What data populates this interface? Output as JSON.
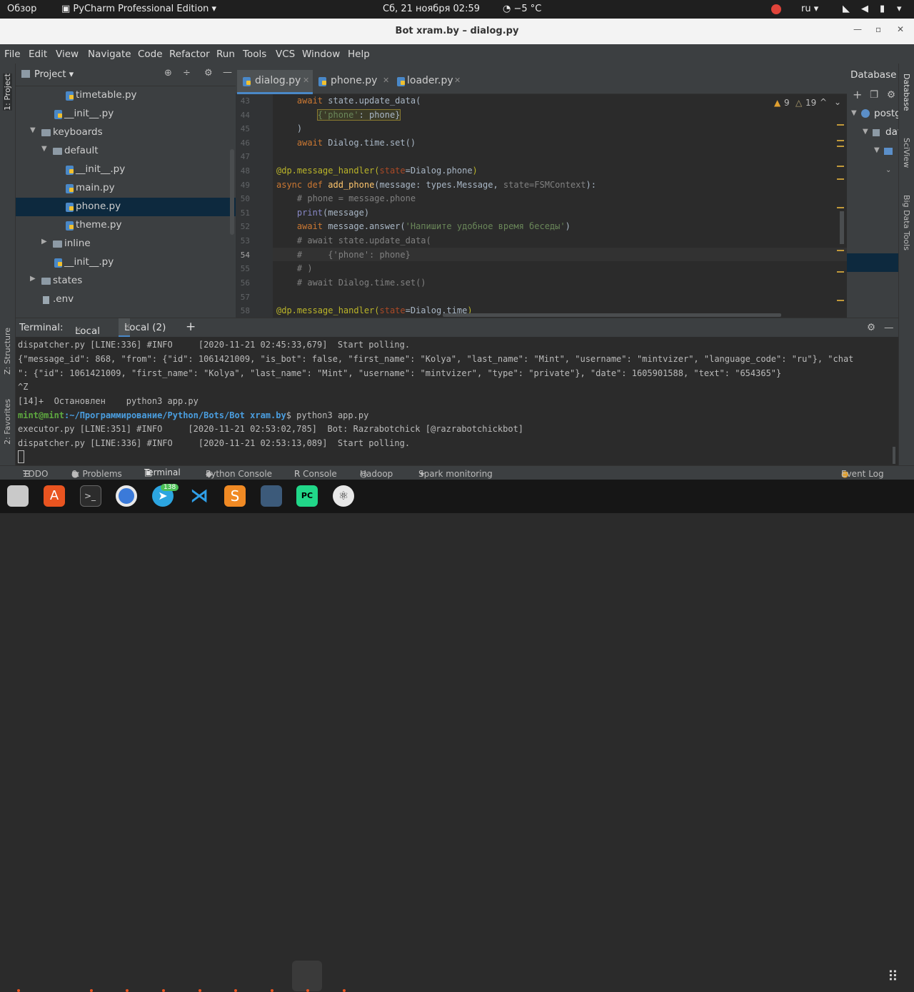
{
  "system_bar": {
    "overview": "Обзор",
    "app_name": "PyCharm Professional Edition",
    "datetime": "Сб, 21 ноября  02:59",
    "weather": "−5 °C",
    "lang": "ru"
  },
  "window": {
    "title": "Bot xram.by – dialog.py"
  },
  "menu": [
    "File",
    "Edit",
    "View",
    "Navigate",
    "Code",
    "Refactor",
    "Run",
    "Tools",
    "VCS",
    "Window",
    "Help"
  ],
  "left_stripe": {
    "project": "1: Project",
    "structure": "Z: Structure",
    "favorites": "2: Favorites"
  },
  "project": {
    "title": "Project",
    "tree": [
      {
        "label": "timetable.py",
        "type": "py"
      },
      {
        "label": "__init__.py",
        "type": "py"
      },
      {
        "label": "keyboards",
        "type": "folder"
      },
      {
        "label": "default",
        "type": "folder"
      },
      {
        "label": "__init__.py",
        "type": "py"
      },
      {
        "label": "main.py",
        "type": "py"
      },
      {
        "label": "phone.py",
        "type": "py"
      },
      {
        "label": "theme.py",
        "type": "py"
      },
      {
        "label": "inline",
        "type": "folder"
      },
      {
        "label": "__init__.py",
        "type": "py"
      },
      {
        "label": "states",
        "type": "folder"
      },
      {
        "label": ".env",
        "type": "file"
      }
    ]
  },
  "editor": {
    "tabs": [
      "dialog.py",
      "phone.py",
      "loader.py"
    ],
    "active_tab": "dialog.py",
    "warnings": "9",
    "weak_warnings": "19",
    "line_numbers": [
      "43",
      "44",
      "45",
      "46",
      "47",
      "48",
      "49",
      "50",
      "51",
      "52",
      "53",
      "54",
      "55",
      "56",
      "57",
      "58"
    ],
    "current_line": "54"
  },
  "db_panel": {
    "title": "Database",
    "item1": "postg",
    "item2": "dat"
  },
  "right_stripe": {
    "database": "Database",
    "sciview": "SciView",
    "bigdata": "Big Data Tools"
  },
  "terminal": {
    "label": "Terminal:",
    "tabs": [
      "Local",
      "Local (2)"
    ],
    "lines": [
      "dispatcher.py [LINE:336] #INFO     [2020-11-21 02:45:33,679]  Start polling.",
      "{\"message_id\": 868, \"from\": {\"id\": 1061421009, \"is_bot\": false, \"first_name\": \"Kolya\", \"last_name\": \"Mint\", \"username\": \"mintvizer\", \"language_code\": \"ru\"}, \"chat",
      "\": {\"id\": 1061421009, \"first_name\": \"Kolya\", \"last_name\": \"Mint\", \"username\": \"mintvizer\", \"type\": \"private\"}, \"date\": 1605901588, \"text\": \"654365\"}",
      "^Z",
      "[14]+  Остановлен    python3 app.py",
      "executor.py [LINE:351] #INFO     [2020-11-21 02:53:02,785]  Bot: Razrabotchick [@razrabotchickbot]",
      "dispatcher.py [LINE:336] #INFO     [2020-11-21 02:53:13,089]  Start polling."
    ],
    "prompt_user": "mint@mint",
    "prompt_path": ":~/Программирование/Python/Bots/Bot xram.by",
    "prompt_cmd": "$ python3 app.py"
  },
  "toolbar": {
    "todo": "TODO",
    "problems": "6: Problems",
    "terminal": "Terminal",
    "python_console": "Python Console",
    "r_console": "R Console",
    "hadoop": "Hadoop",
    "spark": "Spark monitoring",
    "event_log": "Event Log"
  },
  "dock": {
    "telegram_badge": "138"
  }
}
